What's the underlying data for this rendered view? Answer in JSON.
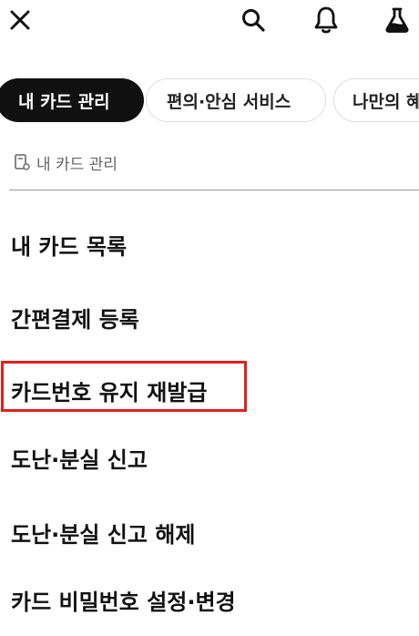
{
  "header": {
    "icons": [
      "close-icon",
      "search-icon",
      "bell-icon",
      "flask-icon"
    ]
  },
  "tabs": [
    {
      "label": "내 카드 관리",
      "active": true
    },
    {
      "label": "편의·안심 서비스",
      "active": false
    },
    {
      "label": "나만의 혜",
      "active": false
    }
  ],
  "section": {
    "icon": "card-settings-icon",
    "title": "내 카드 관리"
  },
  "menu": [
    {
      "label": "내 카드 목록"
    },
    {
      "label": "간편결제 등록"
    },
    {
      "label": "카드번호 유지 재발급",
      "highlighted": true
    },
    {
      "label": "도난·분실 신고"
    },
    {
      "label": "도난·분실 신고 해제"
    },
    {
      "label": "카드 비밀번호 설정·변경"
    }
  ],
  "colors": {
    "active_tab_bg": "#111111",
    "highlight_border": "#e02020",
    "muted_text": "#666666"
  }
}
